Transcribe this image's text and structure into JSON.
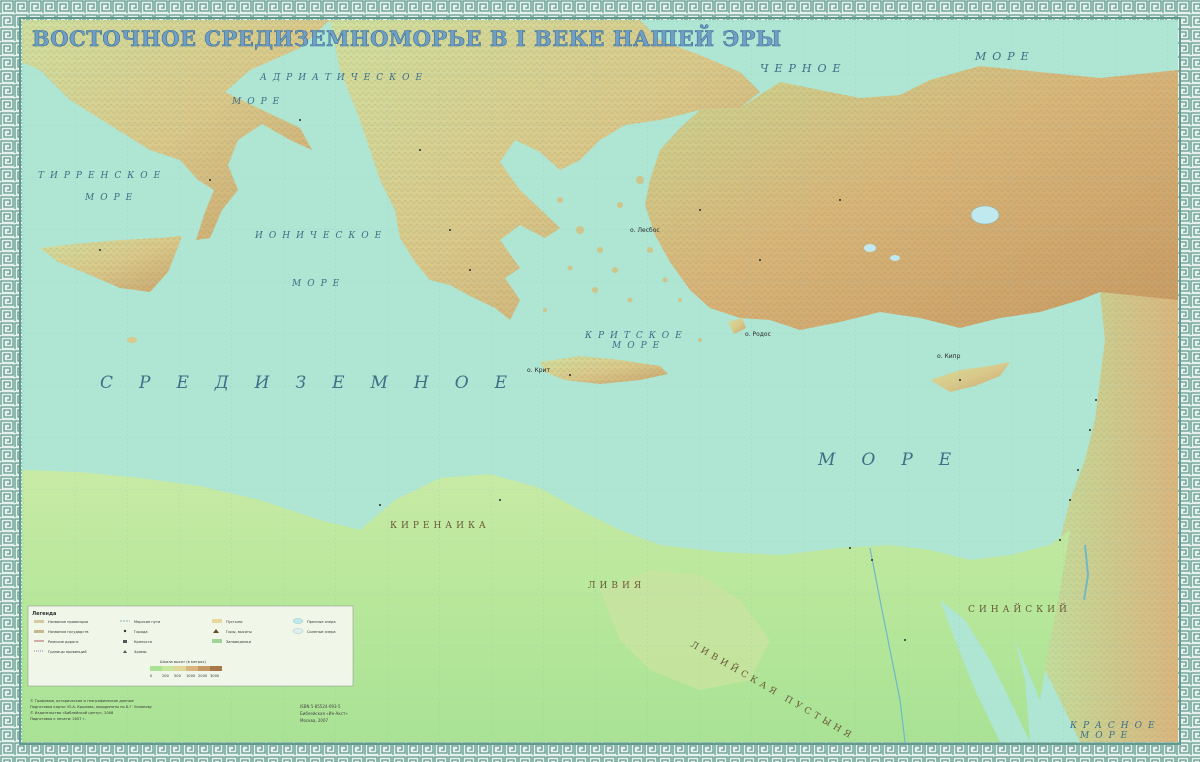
{
  "map": {
    "title": "ВОСТОЧНОЕ СРЕДИЗЕМНОМОРЬЕ В I ВЕКЕ НАШЕЙ ЭРЫ",
    "colors": {
      "sea": "#aee5d3",
      "lowland": "#b9e6a2",
      "upland": "#d9c98a",
      "mountain": "#c59a62",
      "frame": "#5f9a8c",
      "title": "#6f9fc4"
    },
    "seas": {
      "adriatic": "АДРИАТИЧЕСКОЕ",
      "adriatic_more": "МОРЕ",
      "black": "ЧЕРНОЕ",
      "black_more": "МОРЕ",
      "tyrrhenian": "ТИРРЕНСКОЕ",
      "tyrrhenian_more": "МОРЕ",
      "ionian": "ИОНИЧЕСКОЕ",
      "ionian_more": "МОРЕ",
      "mediterranean": "СРЕДИЗЕМНОЕ",
      "mediterranean_more": "МОРЕ",
      "cretan": "КРИТСКОЕ",
      "cretan_more": "МОРЕ",
      "red": "КРАСНОЕ",
      "red_more": "МОРЕ"
    },
    "regions": {
      "cyrenaica": "КИРЕНАИКА",
      "libya": "ЛИВИЯ",
      "libyan_desert": "ЛИВИЙСКАЯ ПУСТЫНЯ",
      "sinai": "СИНАЙСКИЙ"
    },
    "islands": {
      "crete": "о. Крит",
      "cyprus": "о. Кипр",
      "rhodes": "о. Родос",
      "lesbos": "о. Лесбос"
    },
    "legend": {
      "heading": "Легенда",
      "items": [
        "Название провинции",
        "Названия государств",
        "Римские дороги",
        "Границы провинций",
        "Морские пути",
        "Города",
        "Крепости",
        "Храмы",
        "Пустыни",
        "Горы, высоты",
        "Заповедники",
        "Пресные озера",
        "Соленые озера"
      ],
      "scale_label": "Шкала высот (в метрах)",
      "scale_values": [
        "0",
        "200",
        "500",
        "1000",
        "2000",
        "3000"
      ]
    },
    "credits": [
      "© Трофимов, исторические и географические данные",
      "Подготовка карты: Ю.А. Крылова, координаты по Б.Г. Усманову",
      "© Издательство «Библейский центр», 2008",
      "Подготовка к печати: 2007 г."
    ],
    "publisher": [
      "ISBN 5-85524-093-5",
      "Библейская «Ин-Акст»",
      "Москва, 2007"
    ]
  }
}
